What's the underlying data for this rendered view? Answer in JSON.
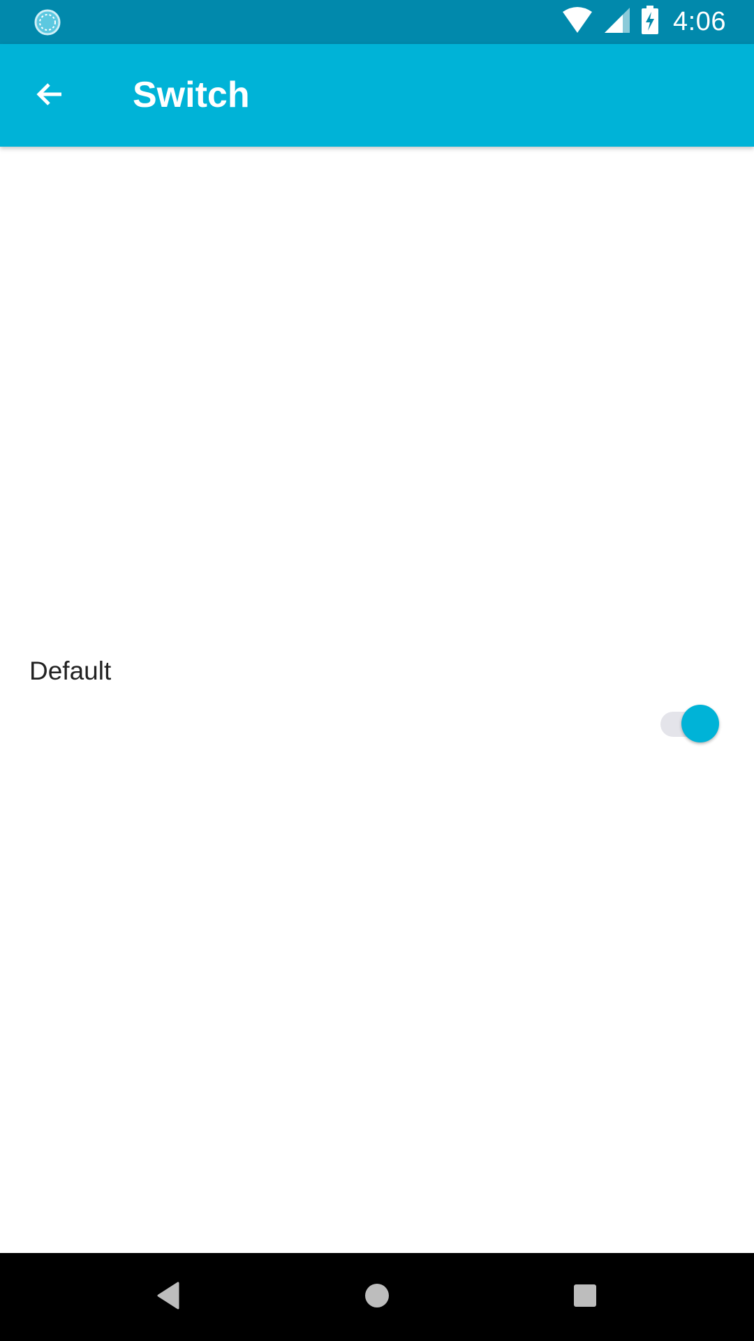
{
  "status_bar": {
    "time": "4:06",
    "icons": [
      "sync-icon",
      "wifi-icon",
      "cell-signal-icon",
      "battery-charging-icon"
    ]
  },
  "app_bar": {
    "title": "Switch",
    "back_icon": "arrow-back-icon"
  },
  "content": {
    "switch_label": "Default",
    "switch_state": "on"
  },
  "nav_bar": {
    "icons": [
      "back-triangle-icon",
      "home-circle-icon",
      "recents-square-icon"
    ]
  },
  "colors": {
    "status_bar": "#0189ac",
    "app_bar": "#00b3d7",
    "accent": "#00b3d7",
    "switch_track": "#e4e4ea",
    "nav_bar": "#000000"
  }
}
